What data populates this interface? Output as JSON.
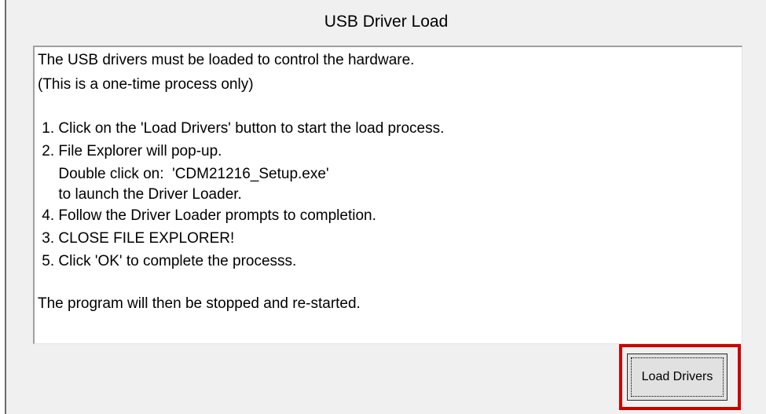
{
  "dialog": {
    "title": "USB Driver Load",
    "instructions": [
      "The USB drivers must be loaded to control the hardware.",
      "(This is a one-time process only)",
      "",
      " 1. Click on the 'Load Drivers' button to start the load process.",
      " 2. File Explorer will pop-up.",
      "     Double click on:  'CDM21216_Setup.exe'",
      "     to launch the Driver Loader.",
      " 4. Follow the Driver Loader prompts to completion.",
      " 3. CLOSE FILE EXPLORER!",
      " 5. Click 'OK' to complete the processs.",
      "",
      "The program will then be stopped and re-started."
    ],
    "load_button_label": "Load Drivers",
    "highlight_color": "#cc0000"
  }
}
